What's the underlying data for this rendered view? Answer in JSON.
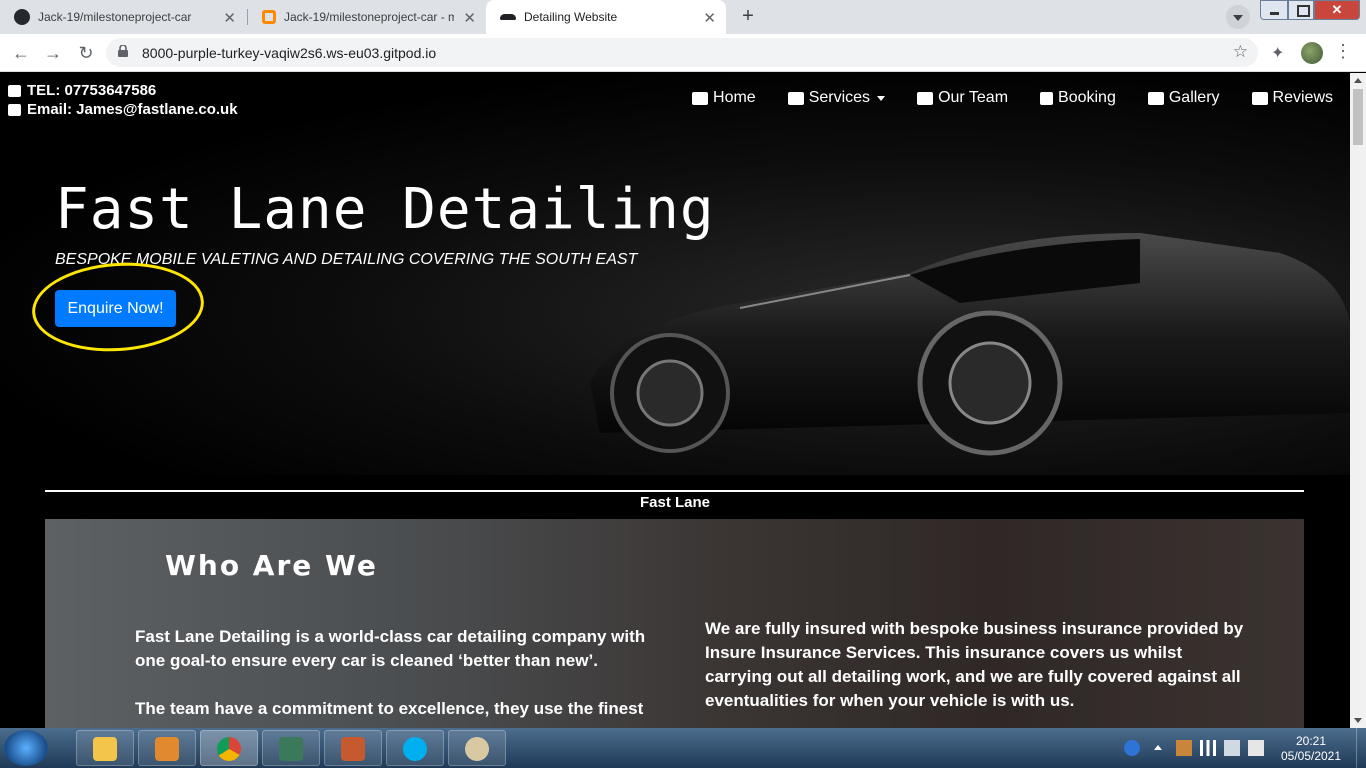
{
  "browser": {
    "tabs": [
      {
        "title": "Jack-19/milestoneproject-car",
        "icon": "github-icon"
      },
      {
        "title": "Jack-19/milestoneproject-car - m",
        "icon": "gitpod-icon"
      },
      {
        "title": "Detailing Website",
        "icon": "car-icon"
      }
    ],
    "url": "8000-purple-turkey-vaqiw2s6.ws-eu03.gitpod.io"
  },
  "site": {
    "contact": {
      "tel": "TEL: 07753647586",
      "email": "Email: James@fastlane.co.uk"
    },
    "nav": {
      "home": "Home",
      "services": "Services",
      "our_team": "Our Team",
      "booking": "Booking",
      "gallery": "Gallery",
      "reviews": "Reviews"
    },
    "hero": {
      "title": "Fast Lane Detailing",
      "subtitle": "BESPOKE MOBILE VALETING AND DETAILING COVERING THE SOUTH EAST",
      "cta": "Enquire Now!"
    },
    "brand_strip": "Fast Lane",
    "about": {
      "heading": "Who Are We",
      "left_p1": "Fast Lane Detailing is a world-class car detailing company with one goal-to ensure every car is cleaned ‘better than new’.",
      "left_p2": "The team have a commitment to excellence, they use the finest",
      "right_p1": "We are fully insured with bespoke business insurance provided by Insure Insurance Services. This insurance covers us whilst carrying out all detailing work, and we are fully covered against all eventualities for when your vehicle is with us."
    }
  },
  "taskbar": {
    "time": "20:21",
    "date": "05/05/2021"
  },
  "colors": {
    "cta": "#007bff",
    "highlight_ring": "#ffe600"
  }
}
